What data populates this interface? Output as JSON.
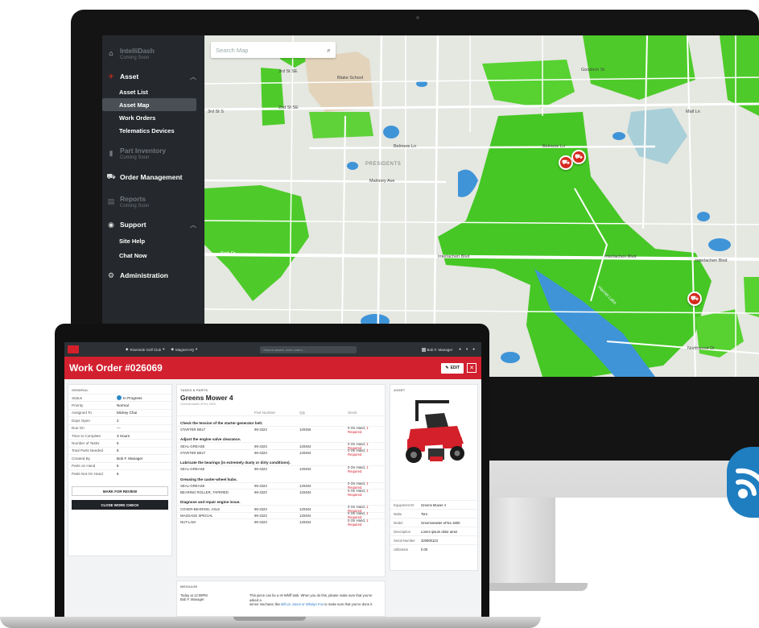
{
  "sidebar": {
    "intellidash": {
      "label": "IntelliDash",
      "sub": "Coming Soon"
    },
    "asset": {
      "label": "Asset"
    },
    "asset_items": [
      "Asset List",
      "Asset Map",
      "Work Orders",
      "Telematics Devices"
    ],
    "part_inventory": {
      "label": "Part Inventory",
      "sub": "Coming Soon"
    },
    "order_management": {
      "label": "Order Management"
    },
    "reports": {
      "label": "Reports",
      "sub": "Coming Soon"
    },
    "support": {
      "label": "Support"
    },
    "support_items": [
      "Site Help",
      "Chat Now"
    ],
    "administration": {
      "label": "Administration"
    }
  },
  "map": {
    "search_placeholder": "Search Map",
    "labels": {
      "third_st_se": "3rd St SE",
      "second_st_se": "2nd St SE",
      "third_st_s": "3rd St S",
      "blake_school": "Blake School",
      "goodrich": "Goodrich St",
      "belmore_ln": "Belmore Ln",
      "belmore_ln_2": "Belmore Ln",
      "presidents": "PRESIDENTS",
      "maloney": "Maloney Ave",
      "mall_ln": "Mall Ln",
      "interlachen": "Interlachen Blvd",
      "interlachen_2": "Interlachen Blvd",
      "interlachen_3": "Interlachen Blvd",
      "northwood": "Northwood Dr",
      "harriet": "Harriet Lake",
      "park_dr": "Park Dr"
    }
  },
  "laptop": {
    "topbar": {
      "ctx1": "Riverside Golf Club",
      "ctx2": "Magnet HQ",
      "search": "Search assets, work orders...",
      "user": "Bob F. Manager"
    },
    "header": {
      "title": "Work Order #026069",
      "edit": "EDIT",
      "close": "✕"
    },
    "general": {
      "heading": "GENERAL",
      "rows": [
        {
          "k": "Status",
          "v": "In Progress"
        },
        {
          "k": "Priority",
          "v": "Normal"
        },
        {
          "k": "Assigned To",
          "v": "Mickey Chai"
        },
        {
          "k": "Days Open",
          "v": "2"
        },
        {
          "k": "Due On",
          "v": "—"
        },
        {
          "k": "Time to Complete",
          "v": "3 Hours"
        },
        {
          "k": "Number of Tasks",
          "v": "5"
        },
        {
          "k": "Total Parts Needed",
          "v": "6"
        },
        {
          "k": "Created By",
          "v": "Bob F. Manager"
        },
        {
          "k": "Parts on Hand",
          "v": "5"
        },
        {
          "k": "Parts Not On Hand",
          "v": "6"
        }
      ],
      "mark_review": "MARK FOR REVIEW",
      "close_check": "CLOSE WORK CHECK"
    },
    "tasks": {
      "heading": "TASKS & PARTS",
      "asset_name": "Greens Mower 4",
      "asset_sub": "Greensmaster eFlex 1800",
      "cols": [
        "",
        "Part Number",
        "Qty",
        "Stock"
      ],
      "groups": [
        {
          "title": "Check the tension of the starter-generator belt.",
          "parts": [
            {
              "n": "STARTER BELT",
              "p": "99-3323",
              "q": "120456",
              "s1": "0 On Hand,",
              "s2": "1 Required"
            }
          ]
        },
        {
          "title": "Adjust the engine valve clearance.",
          "parts": [
            {
              "n": "SEAL-GREASE",
              "p": "99-3323",
              "q": "120484",
              "s1": "0 On Hand,",
              "s2": "1 Required"
            },
            {
              "n": "STARTER BELT",
              "p": "99-3323",
              "q": "120484",
              "s1": "0 On Hand,",
              "s2": "1 Required"
            }
          ]
        },
        {
          "title": "Lubricate the bearings (in extremely dusty or dirty conditions).",
          "parts": [
            {
              "n": "SEAL-GREASE",
              "p": "99-3323",
              "q": "120484",
              "s1": "0 On Hand,",
              "s2": "1 Required"
            }
          ]
        },
        {
          "title": "Greasing the caster-wheel hubs.",
          "parts": [
            {
              "n": "SEAL-GREASE",
              "p": "99-3323",
              "q": "120484",
              "s1": "0 On Hand,",
              "s2": "1 Required"
            },
            {
              "n": "BEARING ROLLER, TAPERED",
              "p": "99-3323",
              "q": "120484",
              "s1": "0 On Hand,",
              "s2": "1 Required"
            }
          ]
        },
        {
          "title": "Diagnose and repair engine issue.",
          "parts": [
            {
              "n": "COVER-BEARING, AXLE",
              "p": "99-3323",
              "q": "120484",
              "s1": "0 On Hand,",
              "s2": "1 Required"
            },
            {
              "n": "MASSAGE SPECIAL",
              "p": "99-3323",
              "q": "120484",
              "s1": "0 On Hand,",
              "s2": "1 Required"
            },
            {
              "n": "NUT-LAM",
              "p": "99-3323",
              "q": "120484",
              "s1": "0 On Hand,",
              "s2": "1 Required"
            }
          ]
        }
      ]
    },
    "messages": {
      "heading": "MESSAGE",
      "who": "Today at 12:09PM",
      "who2": "Bob F. Manager",
      "text": "This piece can be a Hi-Whiff task. When you do this, please make sure that you've asked a",
      "text2a": "senior mechanic like ",
      "link": "Bill Lin Jones or Whalyn Fox",
      "text2b": " to make sure that you've done it"
    },
    "asset": {
      "heading": "ASSET",
      "rows": [
        {
          "k": "Equipment ID",
          "v": "Greens Mower 4"
        },
        {
          "k": "Make",
          "v": "Toro"
        },
        {
          "k": "Model",
          "v": "Greensmaster eFlex 1800"
        },
        {
          "k": "Description",
          "v": "Lorem ipsum dolor amet"
        },
        {
          "k": "Serial Number",
          "v": "320900123"
        },
        {
          "k": "Utilization",
          "v": "0.00"
        }
      ]
    }
  }
}
